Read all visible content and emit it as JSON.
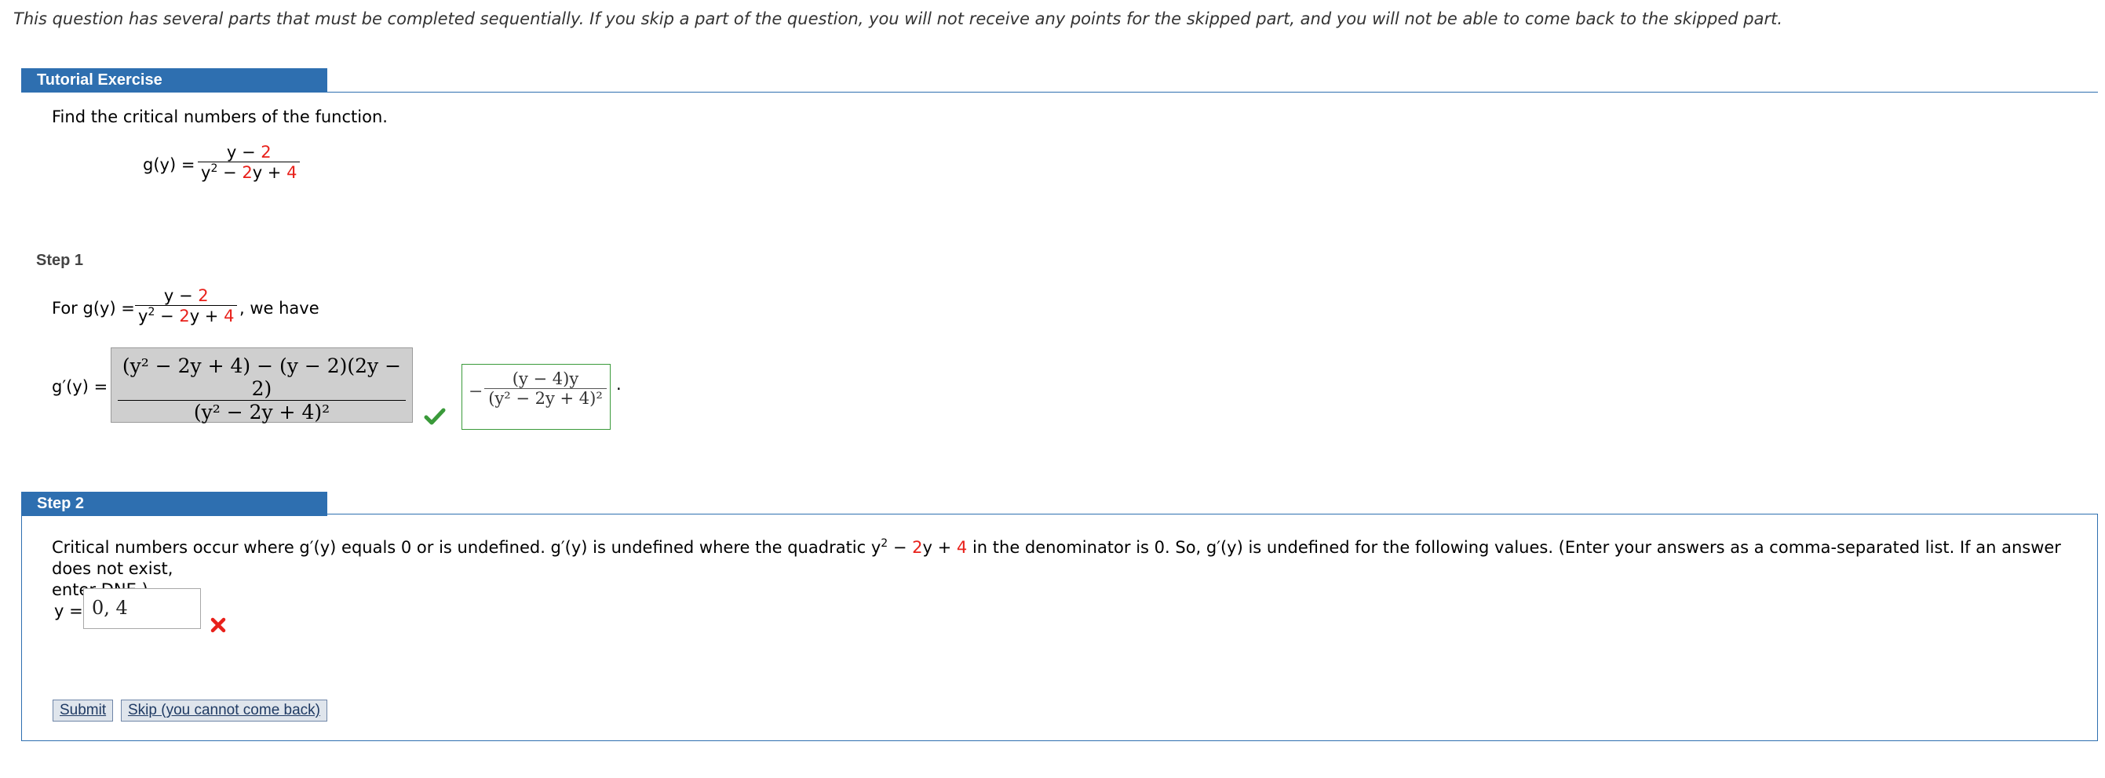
{
  "intro_notice": "This question has several parts that must be completed sequentially. If you skip a part of the question, you will not receive any points for the skipped part, and you will not be able to come back to the skipped part.",
  "tutorial": {
    "header": "Tutorial Exercise",
    "prompt": "Find the critical numbers of the function.",
    "function_lhs": "g(y) =",
    "num": {
      "a": "y − ",
      "b": "2"
    },
    "den": {
      "a": "y",
      "exp": "2",
      "b": " − ",
      "c": "2",
      "d": "y + ",
      "e": "4"
    }
  },
  "step1": {
    "label": "Step 1",
    "for_text": "For g(y) =",
    "we_have": ", we have",
    "deriv_lhs": "g′(y) =",
    "gray_num": "(y² − 2y + 4) − (y − 2)(2y − 2)",
    "gray_den": "(y² − 2y + 4)²",
    "answer_num": "(y − 4)y",
    "answer_den": "(y² − 2y + 4)²",
    "answer_sign": "−",
    "period": "."
  },
  "step2": {
    "label": "Step 2",
    "text_a": "Critical numbers occur where g′(y) equals 0 or is undefined. g′(y) is undefined where the quadratic y",
    "text_exp": "2",
    "text_b": " − ",
    "text_c": "2",
    "text_d": "y + ",
    "text_e": "4",
    "text_f": " in the denominator is 0. So, g′(y) is undefined for the following values. (Enter your answers as a comma-separated list. If an answer does not exist,",
    "text_g": "enter DNE.)",
    "answer_label": "y =",
    "answer_value": "0, 4"
  },
  "buttons": {
    "submit": "Submit",
    "skip": "Skip (you cannot come back)"
  },
  "colors": {
    "accent": "#2e6fb0",
    "red": "#e8201a",
    "correct": "#3a9a3a",
    "wrong": "#e8201a"
  }
}
